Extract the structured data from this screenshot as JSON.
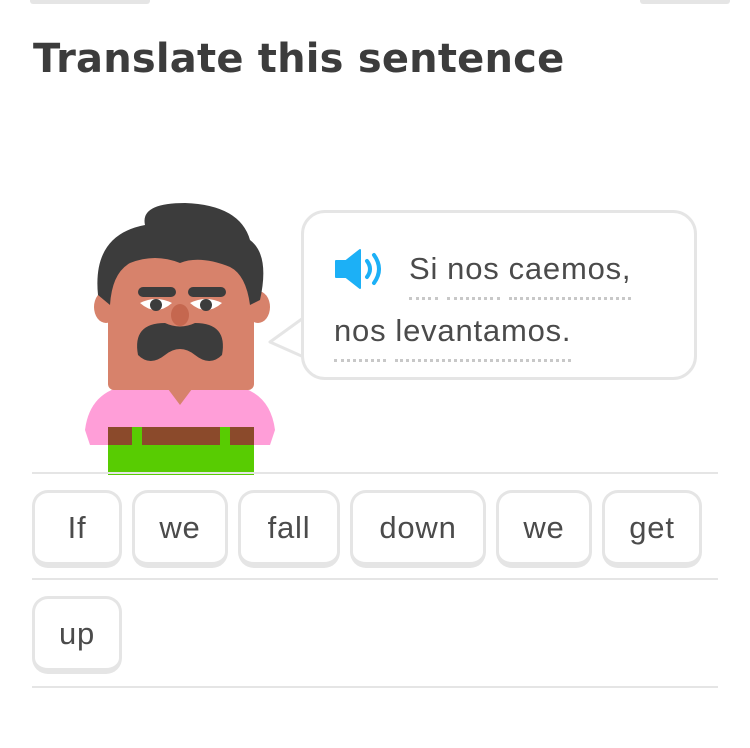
{
  "header": {
    "title": "Translate this sentence"
  },
  "prompt": {
    "speaker_icon": "speaker-icon",
    "line1": [
      "Si",
      "nos",
      "caemos,"
    ],
    "line2": [
      "nos",
      "levantamos."
    ]
  },
  "word_bank": [
    "If",
    "we",
    "fall",
    "down",
    "we",
    "get",
    "up"
  ],
  "colors": {
    "text": "#3c3c3c",
    "border": "#e5e5e5",
    "speaker": "#1cb0f6",
    "shirt": "#ff9ed8",
    "pants": "#58cc02",
    "skin": "#d7826b",
    "hair": "#3c3c3c"
  }
}
